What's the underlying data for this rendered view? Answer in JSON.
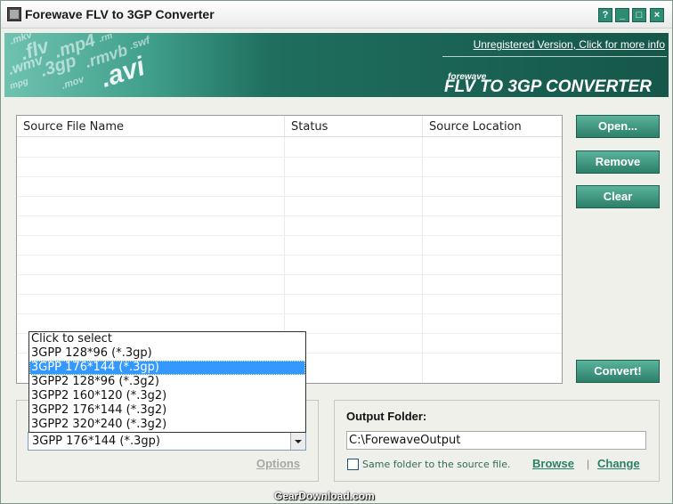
{
  "window": {
    "title": "Forewave FLV to 3GP Converter",
    "controls": {
      "help": "?",
      "minimize": "_",
      "maximize": "□",
      "close": "×"
    }
  },
  "banner": {
    "format_words": [
      ".mkv",
      ".flv",
      ".mp4",
      ".rm",
      ".wmv",
      ".3gp",
      ".rmvb",
      ".swf",
      "mpg",
      ".mov",
      ".avi"
    ],
    "link_text": "Unregistered Version, Click for more info",
    "brand": "forewave",
    "product": "FLV TO 3GP CONVERTER"
  },
  "file_table": {
    "columns": [
      "Source File Name",
      "Status",
      "Source Location"
    ],
    "rows": []
  },
  "buttons": {
    "open": "Open...",
    "remove": "Remove",
    "clear": "Clear",
    "convert": "Convert!"
  },
  "format": {
    "selected": "3GPP 176*144 (*.3gp)",
    "options": [
      "Click to select",
      "3GPP 128*96 (*.3gp)",
      "3GPP 176*144 (*.3gp)",
      "3GPP2 128*96 (*.3g2)",
      "3GPP2 160*120 (*.3g2)",
      "3GPP2 176*144 (*.3g2)",
      "3GPP2 320*240 (*.3g2)"
    ],
    "highlighted_index": 2,
    "options_link": "Options"
  },
  "output": {
    "label": "Output Folder:",
    "path": "C:\\ForewaveOutput",
    "same_folder_label": "Same folder to the source file.",
    "same_folder_checked": false,
    "browse": "Browse",
    "separator": "|",
    "change": "Change"
  },
  "watermark": "GearDownload.com",
  "colors": {
    "accent": "#2c7f69",
    "banner_dark": "#15574a",
    "selection": "#3399ff",
    "link": "#2a8068"
  }
}
